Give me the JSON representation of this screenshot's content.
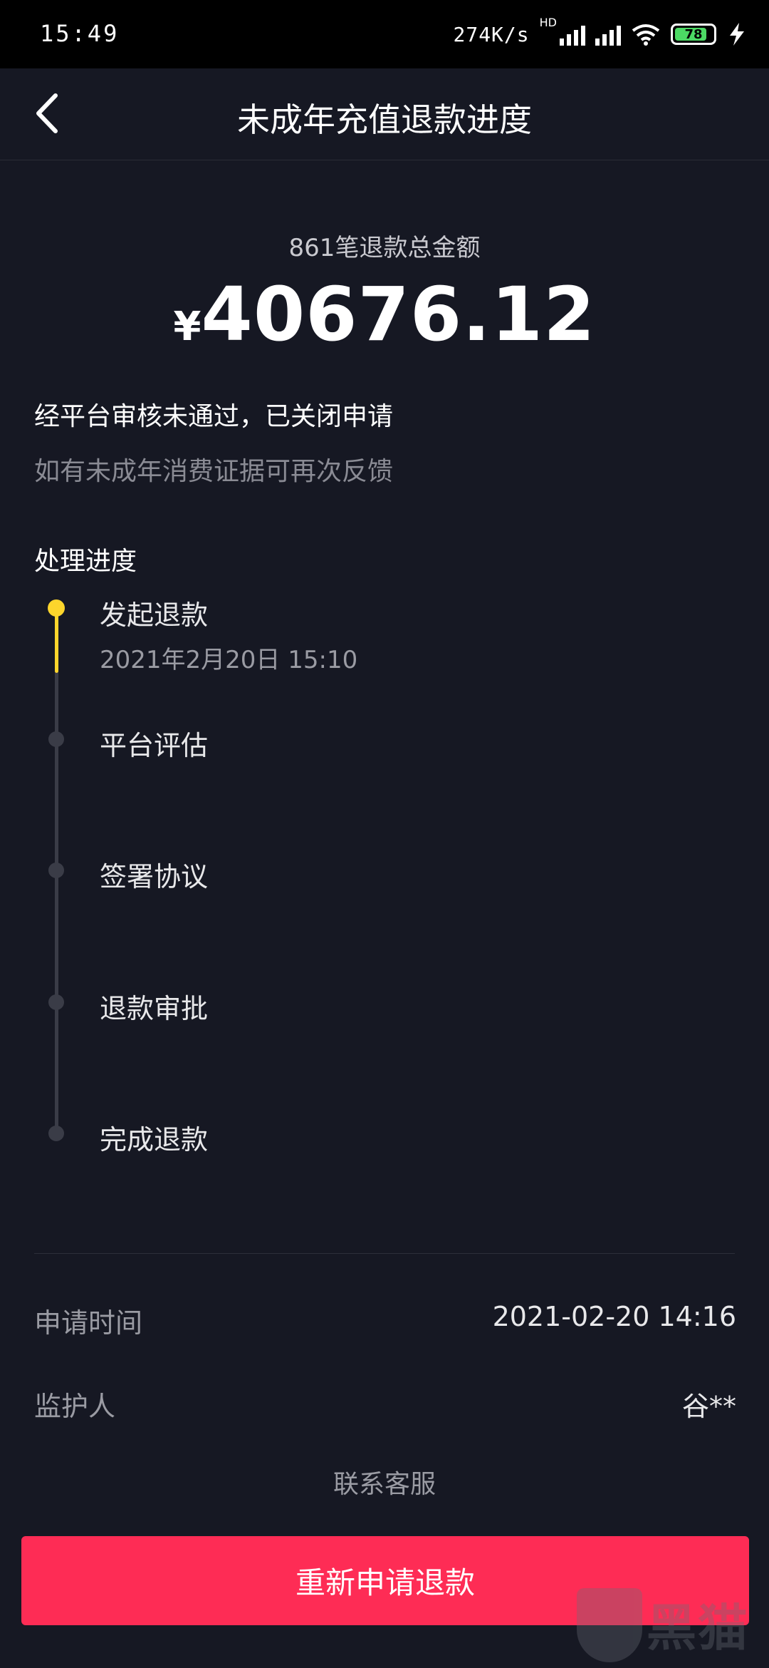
{
  "status_bar": {
    "time": "15:49",
    "net_speed": "274K/s",
    "hd_label": "HD",
    "battery_level": "78"
  },
  "header": {
    "title": "未成年充值退款进度"
  },
  "summary": {
    "label": "861笔退款总金额",
    "currency_symbol": "¥",
    "amount": "40676.12"
  },
  "status": {
    "main": "经平台审核未通过，已关闭申请",
    "sub": "如有未成年消费证据可再次反馈"
  },
  "progress": {
    "title": "处理进度",
    "steps": [
      {
        "label": "发起退款",
        "date": "2021年2月20日 15:10",
        "active": true
      },
      {
        "label": "平台评估",
        "active": false
      },
      {
        "label": "签署协议",
        "active": false
      },
      {
        "label": "退款审批",
        "active": false
      },
      {
        "label": "完成退款",
        "active": false
      }
    ]
  },
  "details": {
    "apply_time_label": "申请时间",
    "apply_time_value": "2021-02-20 14:16",
    "guardian_label": "监护人",
    "guardian_value": "谷**"
  },
  "contact_label": "联系客服",
  "cta_label": "重新申请退款",
  "watermark_text": "黑猫",
  "colors": {
    "background": "#161823",
    "accent_yellow": "#fdd52c",
    "button_red": "#fe2c55",
    "muted_text": "#9a9ba3"
  }
}
